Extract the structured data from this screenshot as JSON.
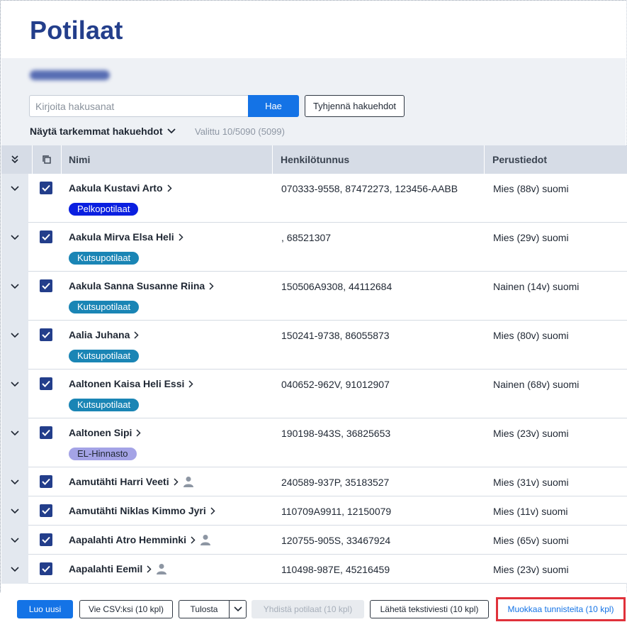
{
  "page": {
    "title": "Potilaat"
  },
  "search": {
    "placeholder": "Kirjoita hakusanat",
    "value": "",
    "search_label": "Hae",
    "clear_label": "Tyhjennä hakuehdot",
    "advanced_label": "Näytä tarkemmat hakuehdot",
    "selected_count": "Valittu 10/5090 (5099)"
  },
  "table": {
    "columns": {
      "name": "Nimi",
      "ssn": "Henkilötunnus",
      "basic": "Perustiedot"
    },
    "rows": [
      {
        "name": "Aakula Kustavi Arto",
        "ssn": "070333-9558, 87472273, 123456-AABB",
        "basic": "Mies (88v) suomi",
        "tag": "Pelkopotilaat",
        "tag_color": "#0a1fe0",
        "person": false,
        "checked": true
      },
      {
        "name": "Aakula Mirva Elsa Heli",
        "ssn": ", 68521307",
        "basic": "Mies (29v) suomi",
        "tag": "Kutsupotilaat",
        "tag_color": "#1a85b5",
        "person": false,
        "checked": true
      },
      {
        "name": "Aakula Sanna Susanne Riina",
        "ssn": "150506A9308, 44112684",
        "basic": "Nainen (14v) suomi",
        "tag": "Kutsupotilaat",
        "tag_color": "#1a85b5",
        "person": false,
        "checked": true
      },
      {
        "name": "Aalia Juhana",
        "ssn": "150241-9738, 86055873",
        "basic": "Mies (80v) suomi",
        "tag": "Kutsupotilaat",
        "tag_color": "#1a85b5",
        "person": false,
        "checked": true
      },
      {
        "name": "Aaltonen Kaisa Heli Essi",
        "ssn": "040652-962V, 91012907",
        "basic": "Nainen (68v) suomi",
        "tag": "Kutsupotilaat",
        "tag_color": "#1a85b5",
        "person": false,
        "checked": true
      },
      {
        "name": "Aaltonen Sipi",
        "ssn": "190198-943S, 36825653",
        "basic": "Mies (23v) suomi",
        "tag": "EL-Hinnasto",
        "tag_color": "#a4a3e6",
        "tag_text_color": "#1f2733",
        "person": false,
        "checked": true
      },
      {
        "name": "Aamutähti Harri Veeti",
        "ssn": "240589-937P, 35183527",
        "basic": "Mies (31v) suomi",
        "tag": "",
        "person": true,
        "checked": true
      },
      {
        "name": "Aamutähti Niklas Kimmo Jyri",
        "ssn": "110709A9911, 12150079",
        "basic": "Mies (11v) suomi",
        "tag": "",
        "person": false,
        "checked": true
      },
      {
        "name": "Aapalahti Atro Hemminki",
        "ssn": "120755-905S, 33467924",
        "basic": "Mies (65v) suomi",
        "tag": "",
        "person": true,
        "checked": true
      },
      {
        "name": "Aapalahti Eemil",
        "ssn": "110498-987E, 45216459",
        "basic": "Mies (23v) suomi",
        "tag": "",
        "person": true,
        "checked": true
      }
    ]
  },
  "footer": {
    "create_new": "Luo uusi",
    "export_csv": "Vie CSV:ksi (10 kpl)",
    "print": "Tulosta",
    "merge": "Yhdistä potilaat (10 kpl)",
    "send_sms": "Lähetä tekstiviesti (10 kpl)",
    "edit_tags": "Muokkaa tunnisteita (10 kpl)"
  },
  "colors": {
    "accent": "#1473e6",
    "title": "#233e8b",
    "checkbox": "#233e8b",
    "highlight": "#e0313a"
  }
}
